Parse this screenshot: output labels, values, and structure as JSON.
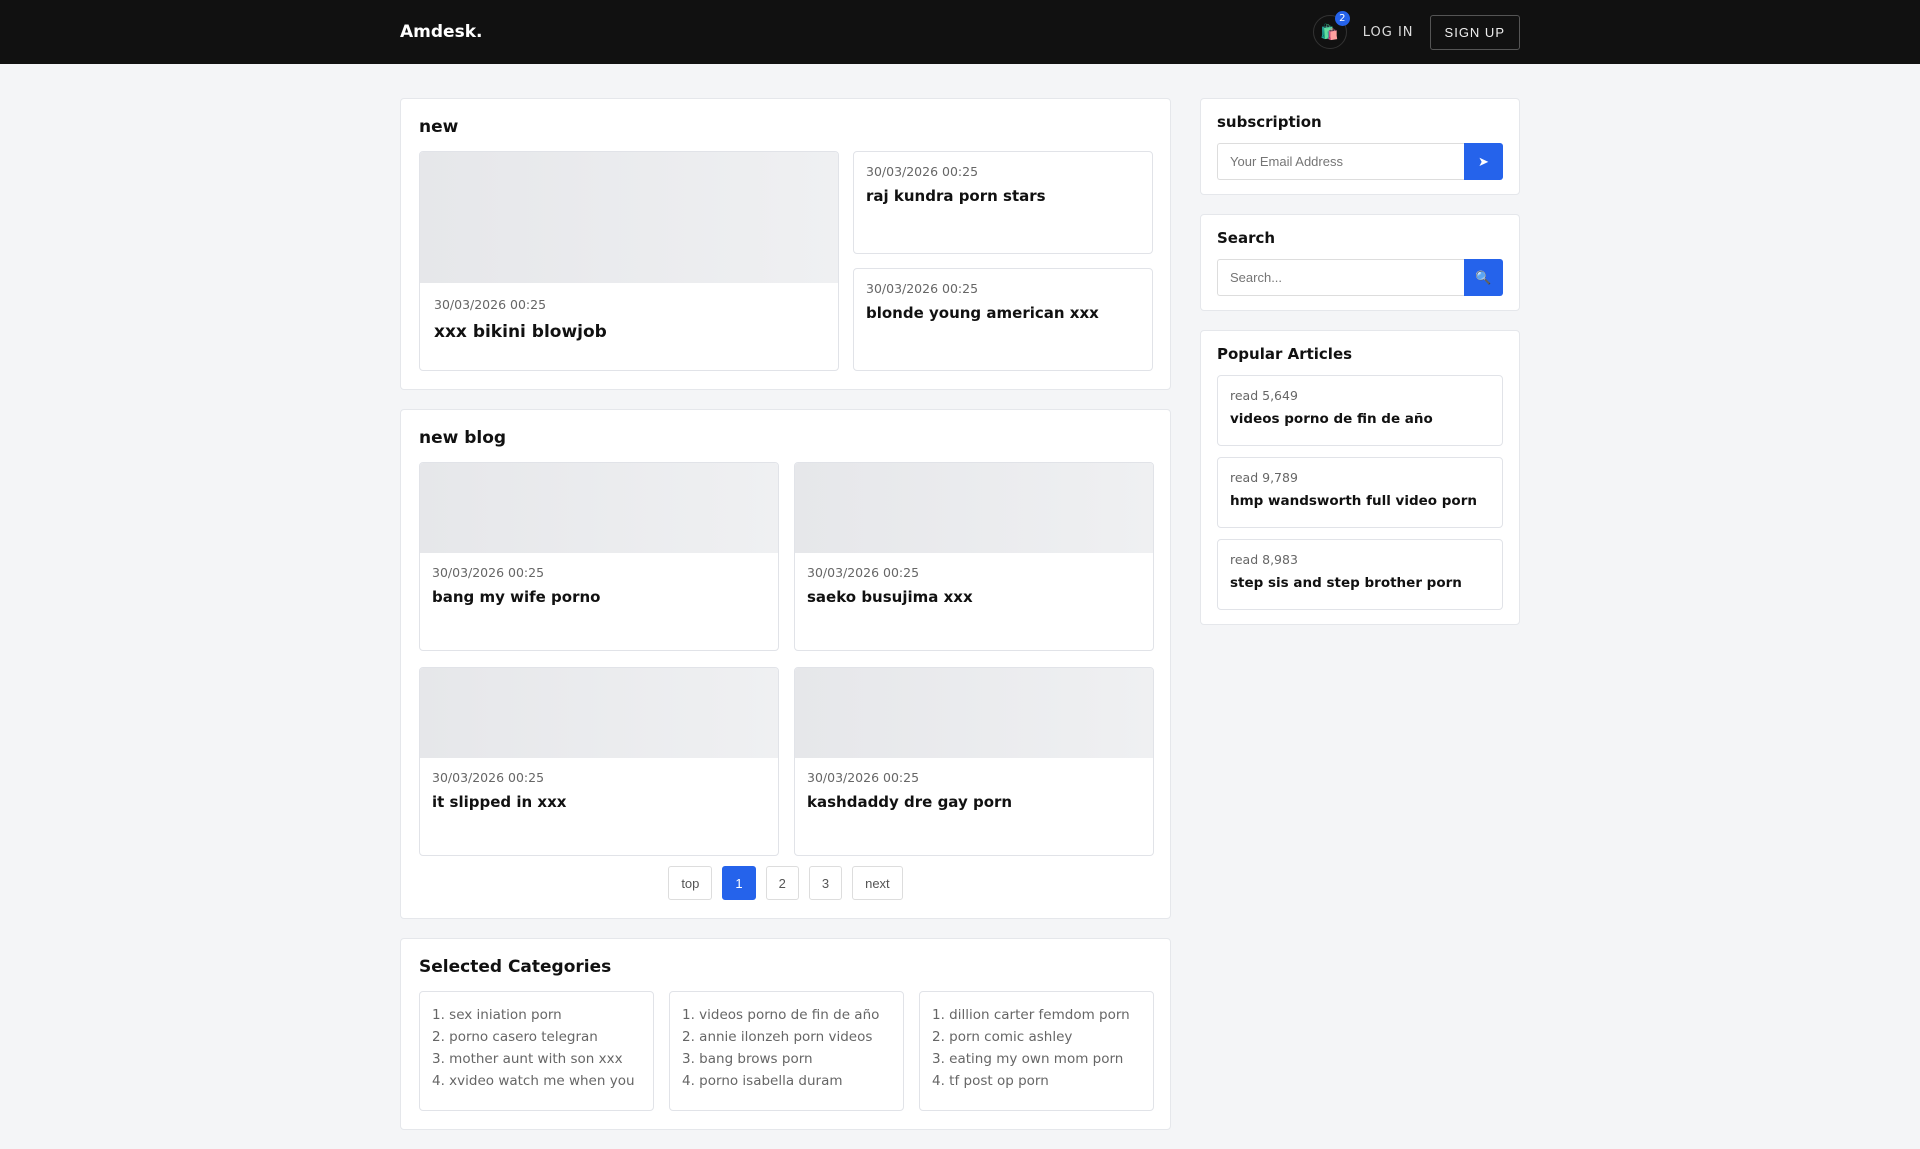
{
  "nav": {
    "logo": "Amdesk.",
    "cart_count": "2",
    "login": "LOG IN",
    "signup": "SIGN UP"
  },
  "new": {
    "title": "new",
    "featured": {
      "date": "30/03/2026 00:25",
      "title": "xxx bikini blowjob"
    },
    "side": [
      {
        "date": "30/03/2026 00:25",
        "title": "raj kundra porn stars"
      },
      {
        "date": "30/03/2026 00:25",
        "title": "blonde young american xxx"
      }
    ]
  },
  "blog": {
    "title": "new blog",
    "posts": [
      {
        "date": "30/03/2026 00:25",
        "title": "bang my wife porno"
      },
      {
        "date": "30/03/2026 00:25",
        "title": "saeko busujima xxx"
      },
      {
        "date": "30/03/2026 00:25",
        "title": "it slipped in xxx"
      },
      {
        "date": "30/03/2026 00:25",
        "title": "kashdaddy dre gay porn"
      }
    ],
    "pagination": [
      "top",
      "1",
      "2",
      "3",
      "next"
    ]
  },
  "categories": {
    "title": "Selected Categories",
    "columns": [
      [
        "1. sex iniation porn",
        "2. porno casero telegran",
        "3. mother aunt with son xxx",
        "4. xvideo watch me when you"
      ],
      [
        "1. videos porno de fin de año",
        "2. annie ilonzeh porn videos",
        "3. bang brows porn",
        "4. porno isabella duram"
      ],
      [
        "1. dillion carter femdom porn",
        "2. porn comic ashley",
        "3. eating my own mom porn",
        "4. tf post op porn"
      ]
    ]
  },
  "subscription": {
    "title": "subscription",
    "placeholder": "Your Email Address",
    "button": "➤"
  },
  "search": {
    "title": "Search",
    "placeholder": "Search...",
    "button": "🔍"
  },
  "popular": {
    "title": "Popular Articles",
    "items": [
      {
        "reads": "read 5,649",
        "title": "videos porno de fin de año"
      },
      {
        "reads": "read 9,789",
        "title": "hmp wandsworth full video porn"
      },
      {
        "reads": "read 8,983",
        "title": "step sis and step brother porn"
      }
    ]
  }
}
